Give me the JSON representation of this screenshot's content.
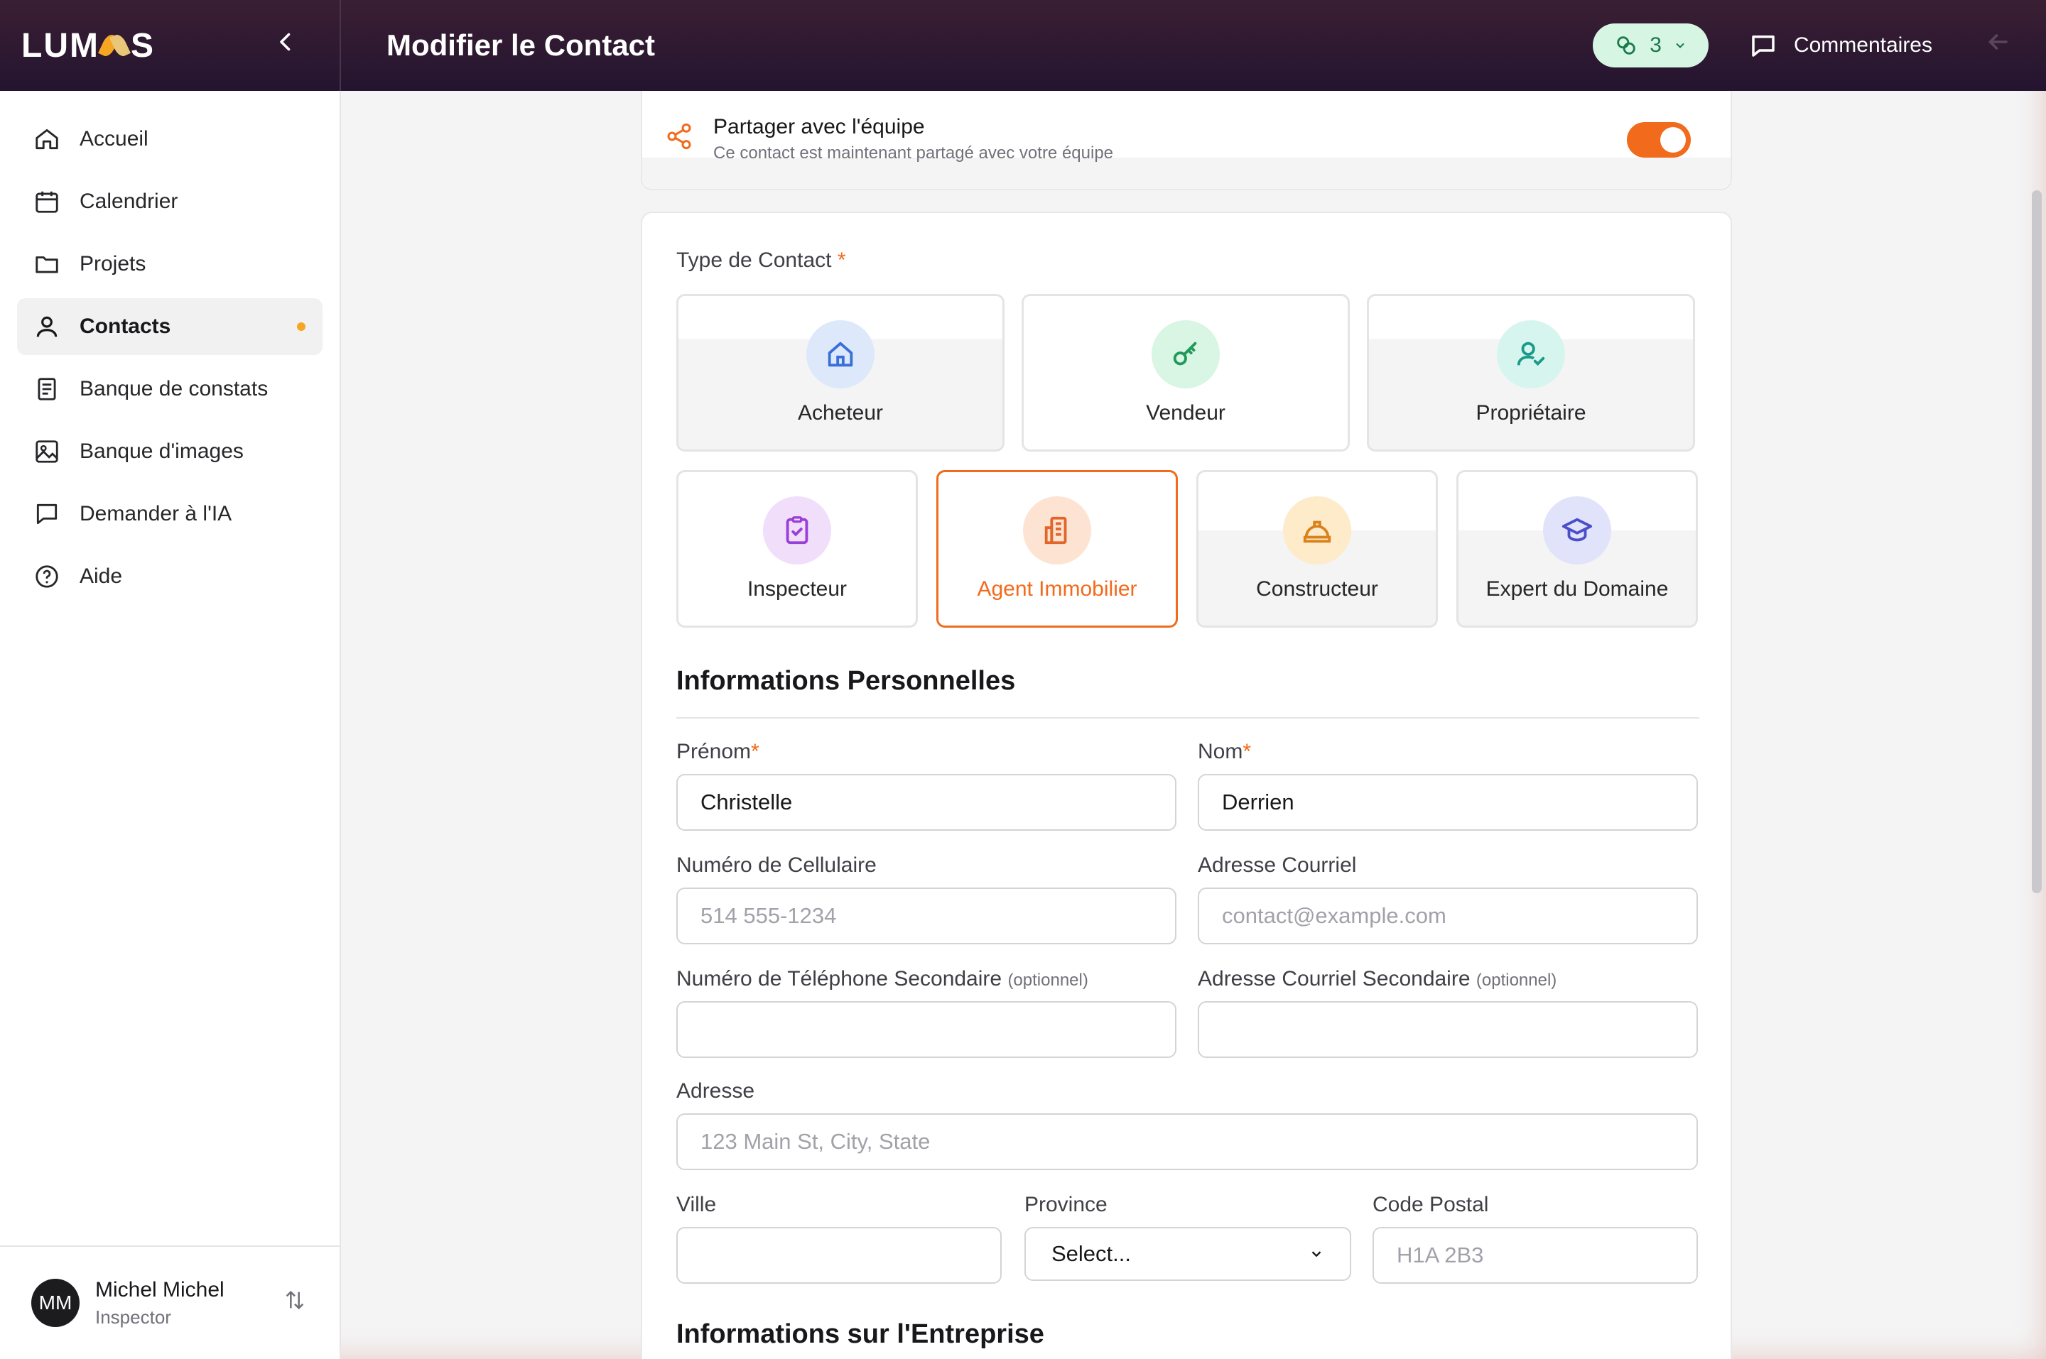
{
  "app": {
    "logo_text_left": "LUM",
    "logo_text_right": "S",
    "page_title": "Modifier le Contact",
    "badge_count": "3",
    "comments_label": "Commentaires"
  },
  "sidebar": {
    "items": [
      {
        "label": "Accueil",
        "icon": "home-icon"
      },
      {
        "label": "Calendrier",
        "icon": "calendar-icon"
      },
      {
        "label": "Projets",
        "icon": "folder-icon"
      },
      {
        "label": "Contacts",
        "icon": "user-icon"
      },
      {
        "label": "Banque de constats",
        "icon": "document-icon"
      },
      {
        "label": "Banque d'images",
        "icon": "image-icon"
      },
      {
        "label": "Demander à l'IA",
        "icon": "chat-icon"
      },
      {
        "label": "Aide",
        "icon": "help-icon"
      }
    ],
    "active_index": 3,
    "user": {
      "initials": "MM",
      "name": "Michel Michel",
      "role": "Inspector"
    }
  },
  "share": {
    "title": "Partager avec l'équipe",
    "subtitle": "Ce contact est maintenant partagé avec votre équipe",
    "enabled": true
  },
  "contact_type": {
    "label": "Type de Contact",
    "required_mark": "*",
    "options": [
      {
        "label": "Acheteur",
        "icon": "house-icon",
        "color": "#3b6fd8",
        "bg": "#dde8fb"
      },
      {
        "label": "Vendeur",
        "icon": "key-icon",
        "color": "#1e9a5a",
        "bg": "#d9f5e4"
      },
      {
        "label": "Propriétaire",
        "icon": "user-check-icon",
        "color": "#1a9a8a",
        "bg": "#d6f5ee"
      },
      {
        "label": "Inspecteur",
        "icon": "clipboard-check-icon",
        "color": "#9a3fd8",
        "bg": "#f0defb"
      },
      {
        "label": "Agent Immobilier",
        "icon": "building-icon",
        "color": "#e2662a",
        "bg": "#fde3d2"
      },
      {
        "label": "Constructeur",
        "icon": "hard-hat-icon",
        "color": "#d9821b",
        "bg": "#fdebc9"
      },
      {
        "label": "Expert du Domaine",
        "icon": "graduation-cap-icon",
        "color": "#4a4fc8",
        "bg": "#e1e3fb"
      }
    ],
    "selected": "Agent Immobilier"
  },
  "personal": {
    "title": "Informations Personnelles",
    "first_name": {
      "label": "Prénom",
      "value": "Christelle"
    },
    "last_name": {
      "label": "Nom",
      "value": "Derrien"
    },
    "mobile": {
      "label": "Numéro de Cellulaire",
      "placeholder": "514 555-1234"
    },
    "email": {
      "label": "Adresse Courriel",
      "placeholder": "contact@example.com"
    },
    "phone2": {
      "label": "Numéro de Téléphone Secondaire",
      "optional": "(optionnel)"
    },
    "email2": {
      "label": "Adresse Courriel Secondaire",
      "optional": "(optionnel)"
    },
    "address": {
      "label": "Adresse",
      "placeholder": "123 Main St, City, State"
    },
    "city": {
      "label": "Ville"
    },
    "province": {
      "label": "Province",
      "value": "Select..."
    },
    "postal": {
      "label": "Code Postal",
      "placeholder": "H1A 2B3"
    }
  },
  "company": {
    "title": "Informations sur l'Entreprise"
  }
}
